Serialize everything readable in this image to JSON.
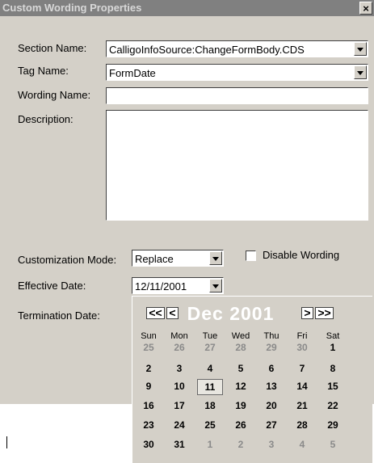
{
  "window": {
    "title": "Custom Wording Properties",
    "close_glyph": "×"
  },
  "labels": {
    "section_name": "Section Name:",
    "tag_name": "Tag Name:",
    "wording_name": "Wording Name:",
    "description": "Description:",
    "customization_mode": "Customization Mode:",
    "disable_wording": "Disable Wording",
    "effective_date": "Effective Date:",
    "termination_date": "Termination Date:"
  },
  "fields": {
    "section_name": "CalligoInfoSource:ChangeFormBody.CDS",
    "tag_name": "FormDate",
    "wording_name": "",
    "description": "",
    "customization_mode": "Replace",
    "disable_wording_checked": false,
    "effective_date": "12/11/2001"
  },
  "calendar": {
    "month_label": "Dec 2001",
    "nav": {
      "prev_year": "<<",
      "prev_month": "<",
      "next_month": ">",
      "next_year": ">>"
    },
    "weekdays": [
      "Sun",
      "Mon",
      "Tue",
      "Wed",
      "Thu",
      "Fri",
      "Sat"
    ],
    "weeks": [
      [
        "25",
        "26",
        "27",
        "28",
        "29",
        "30",
        "1"
      ],
      [
        "2",
        "3",
        "4",
        "5",
        "6",
        "7",
        "8"
      ],
      [
        "9",
        "10",
        "11",
        "12",
        "13",
        "14",
        "15"
      ],
      [
        "16",
        "17",
        "18",
        "19",
        "20",
        "21",
        "22"
      ],
      [
        "23",
        "24",
        "25",
        "26",
        "27",
        "28",
        "29"
      ],
      [
        "30",
        "31",
        "1",
        "2",
        "3",
        "4",
        "5"
      ]
    ],
    "other_month_days": {
      "first_week_count": 6,
      "last_week_count": 5
    },
    "selected_day": "11"
  },
  "colors": {
    "title_bar": "#808080",
    "dialog_face": "#d4d0c8",
    "month_label": "#ffffff"
  },
  "icons": {
    "close": "close-icon",
    "dropdown": "dropdown-arrow-icon"
  }
}
